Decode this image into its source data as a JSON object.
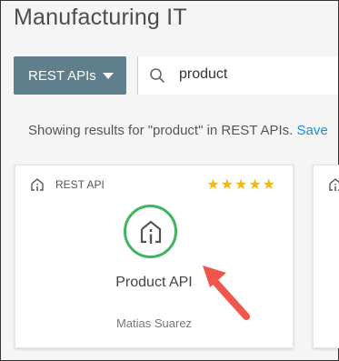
{
  "header": {
    "title": "Manufacturing IT"
  },
  "toolbar": {
    "type_filter_label": "REST APIs",
    "search_value": "product"
  },
  "results": {
    "summary_text": "Showing results for \"product\" in REST APIs.",
    "save_link_label": "Save"
  },
  "cards": [
    {
      "type_label": "REST API",
      "rating_stars": "★★★★★",
      "rating": 5,
      "title": "Product API",
      "owner": "Matias Suarez",
      "icon": "api-icon",
      "status_color": "#3fb55f"
    }
  ],
  "colors": {
    "accent": "#5f7f8c",
    "link": "#1a8fd6",
    "star": "#f5b90a",
    "arrow": "#f0574a"
  }
}
